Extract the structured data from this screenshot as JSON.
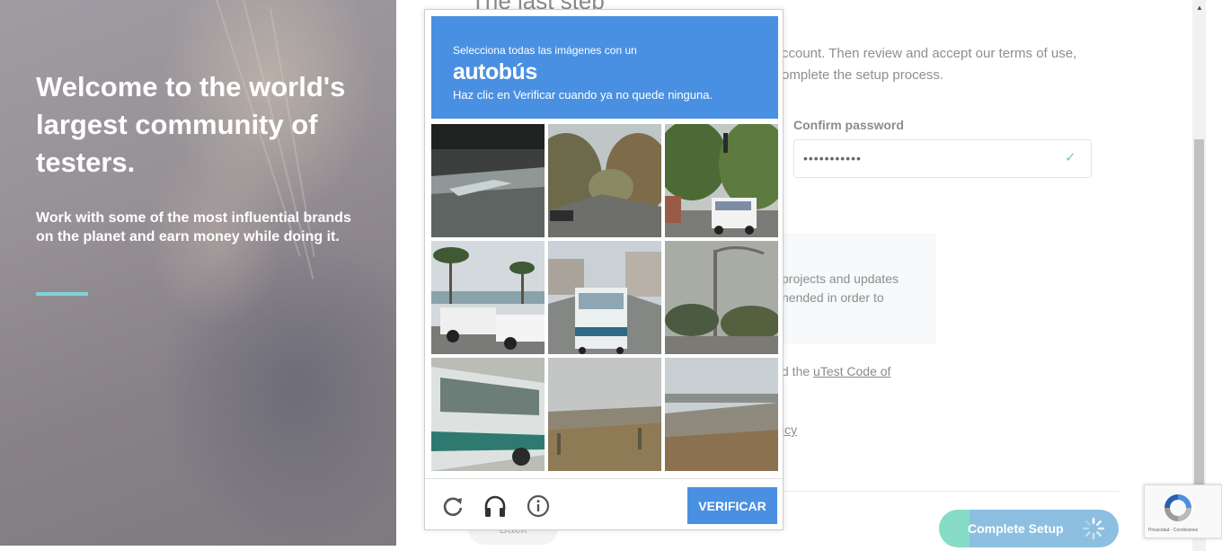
{
  "hero": {
    "headline": "Welcome to the world's largest community of testers.",
    "subtext": "Work with some of the most influential brands on the planet and earn money while doing it.",
    "accent_bar_color": "#7fd3d8"
  },
  "form": {
    "step_title": "The last step",
    "intro": "ccount. Then review and accept our terms of use, omplete the setup process.",
    "confirm_password_label": "Confirm password",
    "confirm_password_value": "•••••••••••",
    "confirm_check_icon": "check-icon",
    "notice_text": "projects and updates nended in order to",
    "code_of_conduct_prefix": "d the ",
    "code_of_conduct_link": "uTest Code of",
    "policy_fragment": "icy",
    "back_label": "Back",
    "complete_label": "Complete Setup"
  },
  "captcha": {
    "instruction_small": "Selecciona todas las imágenes con un",
    "target": "autobús",
    "instruction_hint": "Haz clic en Verificar cuando ya no quede ninguna.",
    "verify_label": "VERIFICAR",
    "accent_color": "#4a90e2",
    "tiles": [
      "road-underpass",
      "tree-lined-road",
      "white-bus-street",
      "pickup-trucks-palms",
      "city-bus-rear",
      "street-light-trees",
      "bus-side-close",
      "overpass-hill",
      "bridge-field"
    ],
    "footer_icons": [
      "reload-icon",
      "audio-headphones-icon",
      "info-icon"
    ]
  },
  "recaptcha_badge": {
    "text": "Privacidad - Condiciones"
  },
  "colors": {
    "complete_left": "#86dcc5",
    "complete_right": "#8cbfe0"
  }
}
